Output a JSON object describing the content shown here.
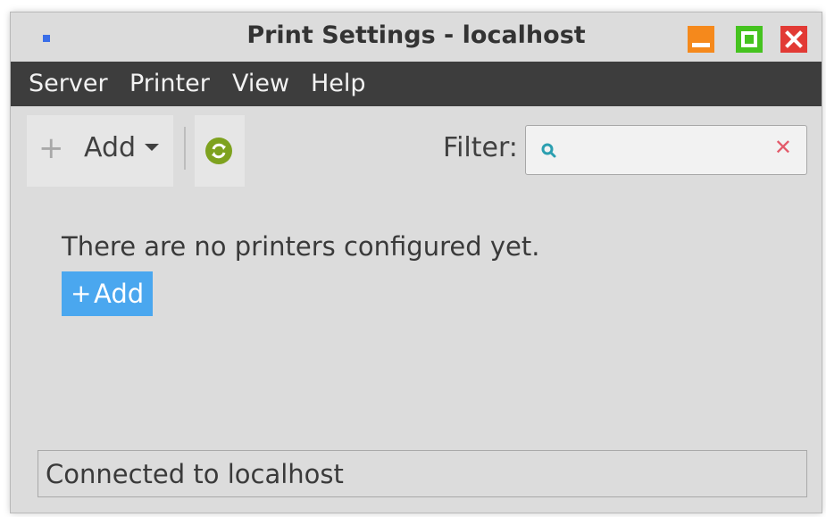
{
  "window": {
    "title": "Print Settings - localhost"
  },
  "menubar": {
    "items": [
      "Server",
      "Printer",
      "View",
      "Help"
    ]
  },
  "toolbar": {
    "add_label": "Add",
    "filter_label": "Filter:",
    "filter_value": "",
    "icons": {
      "add": "plus-icon",
      "dropdown": "caret-down-icon",
      "refresh": "refresh-icon",
      "search": "search-icon",
      "clear": "clear-icon"
    }
  },
  "main": {
    "empty_message": "There are no printers configured yet.",
    "add_button_label": "Add"
  },
  "status": {
    "text": "Connected to localhost"
  },
  "colors": {
    "menubar_bg": "#3d3d3d",
    "add_button_bg": "#4aa7ef",
    "minimize": "#f5891c",
    "maximize": "#45c31f",
    "close": "#e23a35",
    "refresh": "#7ea21f"
  }
}
